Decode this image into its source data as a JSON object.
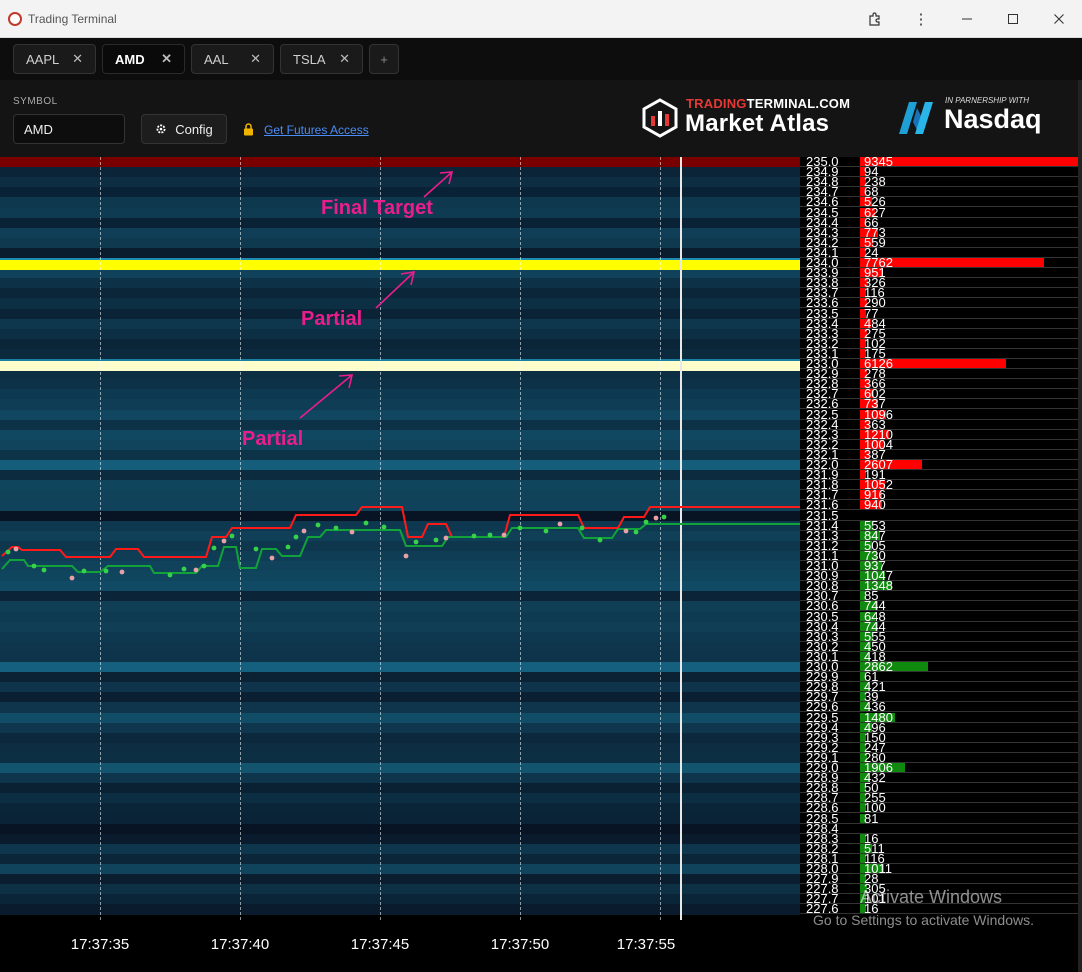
{
  "window": {
    "title": "Trading Terminal",
    "extension_icon": "puzzle-icon",
    "menu_icon": "more-vertical-icon"
  },
  "tabs": [
    {
      "label": "AAPL",
      "active": false
    },
    {
      "label": "AMD",
      "active": true
    },
    {
      "label": "AAL",
      "active": false
    },
    {
      "label": "TSLA",
      "active": false
    }
  ],
  "tab_close_glyph": "✕",
  "tab_add_glyph": "+",
  "header": {
    "symbol_label": "SYMBOL",
    "symbol_value": "AMD",
    "config_label": "Config",
    "futures_link": "Get Futures Access"
  },
  "brand": {
    "top_red": "TRADING",
    "top_white": "TERMINAL.COM",
    "main": "Market Atlas",
    "partner_text": "IN PARNERSHIP WITH",
    "partner_name": "Nasdaq"
  },
  "colors": {
    "ask_bar": "#ff0000",
    "bid_bar": "#0f8a0f",
    "key_level_yellow": "#ffff00",
    "key_level_cream": "#ffffcc",
    "annotation": "#e91e8c",
    "ask_line": "#ff1a1a",
    "bid_line": "#11a33a"
  },
  "annotations": [
    {
      "text": "Final Target"
    },
    {
      "text": "Partial"
    },
    {
      "text": "Partial"
    }
  ],
  "order_book": {
    "levels": [
      {
        "price": "235.0",
        "vol": "9345",
        "side": "ask"
      },
      {
        "price": "234.9",
        "vol": "94",
        "side": "ask"
      },
      {
        "price": "234.8",
        "vol": "238",
        "side": "ask"
      },
      {
        "price": "234.7",
        "vol": "68",
        "side": "ask"
      },
      {
        "price": "234.6",
        "vol": "526",
        "side": "ask"
      },
      {
        "price": "234.5",
        "vol": "627",
        "side": "ask"
      },
      {
        "price": "234.4",
        "vol": "66",
        "side": "ask"
      },
      {
        "price": "234.3",
        "vol": "773",
        "side": "ask"
      },
      {
        "price": "234.2",
        "vol": "559",
        "side": "ask"
      },
      {
        "price": "234.1",
        "vol": "24",
        "side": "ask"
      },
      {
        "price": "234.0",
        "vol": "7762",
        "side": "ask"
      },
      {
        "price": "233.9",
        "vol": "951",
        "side": "ask"
      },
      {
        "price": "233.8",
        "vol": "326",
        "side": "ask"
      },
      {
        "price": "233.7",
        "vol": "116",
        "side": "ask"
      },
      {
        "price": "233.6",
        "vol": "290",
        "side": "ask"
      },
      {
        "price": "233.5",
        "vol": "77",
        "side": "ask"
      },
      {
        "price": "233.4",
        "vol": "484",
        "side": "ask"
      },
      {
        "price": "233.3",
        "vol": "275",
        "side": "ask"
      },
      {
        "price": "233.2",
        "vol": "102",
        "side": "ask"
      },
      {
        "price": "233.1",
        "vol": "175",
        "side": "ask"
      },
      {
        "price": "233.0",
        "vol": "6126",
        "side": "ask"
      },
      {
        "price": "232.9",
        "vol": "278",
        "side": "ask"
      },
      {
        "price": "232.8",
        "vol": "366",
        "side": "ask"
      },
      {
        "price": "232.7",
        "vol": "602",
        "side": "ask"
      },
      {
        "price": "232.6",
        "vol": "737",
        "side": "ask"
      },
      {
        "price": "232.5",
        "vol": "1096",
        "side": "ask"
      },
      {
        "price": "232.4",
        "vol": "363",
        "side": "ask"
      },
      {
        "price": "232.3",
        "vol": "1210",
        "side": "ask"
      },
      {
        "price": "232.2",
        "vol": "1004",
        "side": "ask"
      },
      {
        "price": "232.1",
        "vol": "387",
        "side": "ask"
      },
      {
        "price": "232.0",
        "vol": "2607",
        "side": "ask"
      },
      {
        "price": "231.9",
        "vol": "191",
        "side": "ask"
      },
      {
        "price": "231.8",
        "vol": "1052",
        "side": "ask"
      },
      {
        "price": "231.7",
        "vol": "916",
        "side": "ask"
      },
      {
        "price": "231.6",
        "vol": "940",
        "side": "ask"
      },
      {
        "price": "231.5",
        "vol": "",
        "side": "ask"
      },
      {
        "price": "231.4",
        "vol": "553",
        "side": "bid"
      },
      {
        "price": "231.3",
        "vol": "847",
        "side": "bid"
      },
      {
        "price": "231.2",
        "vol": "505",
        "side": "bid"
      },
      {
        "price": "231.1",
        "vol": "730",
        "side": "bid"
      },
      {
        "price": "231.0",
        "vol": "937",
        "side": "bid"
      },
      {
        "price": "230.9",
        "vol": "1047",
        "side": "bid"
      },
      {
        "price": "230.8",
        "vol": "1348",
        "side": "bid"
      },
      {
        "price": "230.7",
        "vol": "85",
        "side": "bid"
      },
      {
        "price": "230.6",
        "vol": "744",
        "side": "bid"
      },
      {
        "price": "230.5",
        "vol": "648",
        "side": "bid"
      },
      {
        "price": "230.4",
        "vol": "744",
        "side": "bid"
      },
      {
        "price": "230.3",
        "vol": "555",
        "side": "bid"
      },
      {
        "price": "230.2",
        "vol": "450",
        "side": "bid"
      },
      {
        "price": "230.1",
        "vol": "418",
        "side": "bid"
      },
      {
        "price": "230.0",
        "vol": "2862",
        "side": "bid"
      },
      {
        "price": "229.9",
        "vol": "61",
        "side": "bid"
      },
      {
        "price": "229.8",
        "vol": "421",
        "side": "bid"
      },
      {
        "price": "229.7",
        "vol": "39",
        "side": "bid"
      },
      {
        "price": "229.6",
        "vol": "436",
        "side": "bid"
      },
      {
        "price": "229.5",
        "vol": "1480",
        "side": "bid"
      },
      {
        "price": "229.4",
        "vol": "496",
        "side": "bid"
      },
      {
        "price": "229.3",
        "vol": "150",
        "side": "bid"
      },
      {
        "price": "229.2",
        "vol": "247",
        "side": "bid"
      },
      {
        "price": "229.1",
        "vol": "280",
        "side": "bid"
      },
      {
        "price": "229.0",
        "vol": "1906",
        "side": "bid"
      },
      {
        "price": "228.9",
        "vol": "432",
        "side": "bid"
      },
      {
        "price": "228.8",
        "vol": "50",
        "side": "bid"
      },
      {
        "price": "228.7",
        "vol": "255",
        "side": "bid"
      },
      {
        "price": "228.6",
        "vol": "100",
        "side": "bid"
      },
      {
        "price": "228.5",
        "vol": "81",
        "side": "bid"
      },
      {
        "price": "228.4",
        "vol": "",
        "side": "bid"
      },
      {
        "price": "228.3",
        "vol": "16",
        "side": "bid"
      },
      {
        "price": "228.2",
        "vol": "511",
        "side": "bid"
      },
      {
        "price": "228.1",
        "vol": "116",
        "side": "bid"
      },
      {
        "price": "228.0",
        "vol": "1011",
        "side": "bid"
      },
      {
        "price": "227.9",
        "vol": "28",
        "side": "bid"
      },
      {
        "price": "227.8",
        "vol": "305",
        "side": "bid"
      },
      {
        "price": "227.7",
        "vol": "101",
        "side": "bid"
      },
      {
        "price": "227.6",
        "vol": "16",
        "side": "bid"
      }
    ]
  },
  "time_axis": [
    "17:37:35",
    "17:37:40",
    "17:37:45",
    "17:37:50",
    "17:37:55"
  ],
  "watermark": {
    "line1": "Activate Windows",
    "line2": "Go to Settings to activate Windows."
  }
}
